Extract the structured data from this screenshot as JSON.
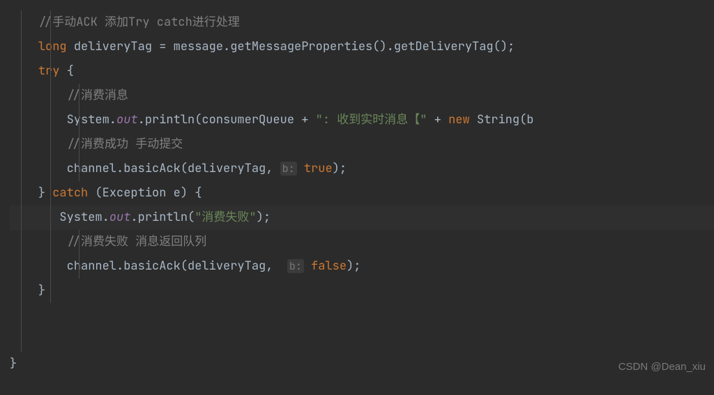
{
  "code": {
    "line1": "//手动ACK 添加Try catch进行处理",
    "line2_kw": "long",
    "line2_var": " deliveryTag = message.getMessageProperties().getDeliveryTag();",
    "line3_kw": "try",
    "line3_brace": " {",
    "line4": "//消费消息",
    "line5_pre": "System.",
    "line5_out": "out",
    "line5_dot": ".",
    "line5_method": "println",
    "line5_open": "(consumerQueue + ",
    "line5_str": "\": 收到实时消息【\"",
    "line5_plus": " + ",
    "line5_new": "new",
    "line5_rest": " String(b",
    "line6": "//消费成功 手动提交",
    "line7_pre": "channel.",
    "line7_method": "basicAck",
    "line7_open": "(deliveryTag, ",
    "line7_hint": "b:",
    "line7_sp": " ",
    "line7_true": "true",
    "line7_close": ");",
    "line8_close": "} ",
    "line8_catch": "catch",
    "line8_mid": " (Exception e) {",
    "line9_pre": "System.",
    "line9_out": "out",
    "line9_dot": ".",
    "line9_method": "println",
    "line9_open": "(",
    "line9_str": "\"消费失败\"",
    "line9_close": ");",
    "line10": "//消费失败 消息返回队列",
    "line11_pre": "channel.",
    "line11_method": "basicAck",
    "line11_open": "(deliveryTag,  ",
    "line11_hint": "b:",
    "line11_sp": " ",
    "line11_false": "false",
    "line11_close": ");",
    "line12": "}",
    "line13": "}"
  },
  "watermark": "CSDN @Dean_xiu"
}
